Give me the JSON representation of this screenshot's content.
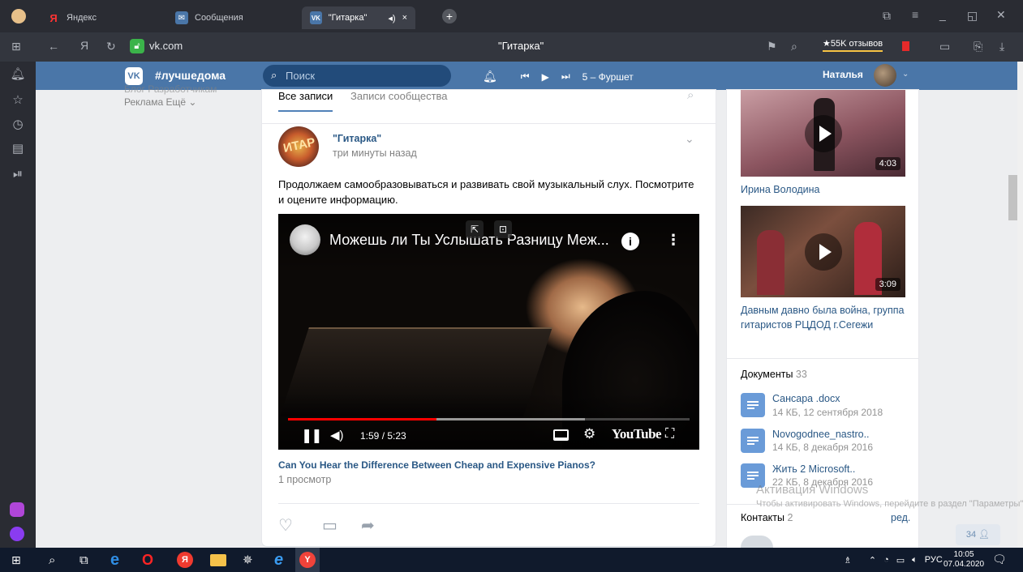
{
  "browser": {
    "tabs": [
      {
        "label": "Яндекс",
        "favicon": "Я"
      },
      {
        "label": "Сообщения",
        "favicon": "VK"
      },
      {
        "label": "\"Гитарка\"",
        "favicon": "VK"
      }
    ],
    "url": "vk.com",
    "page_title": "\"Гитарка\"",
    "reviews": "★55K отзывов"
  },
  "vk_header": {
    "logo": "vk",
    "hashtag": "#лучшедома",
    "search_placeholder": "Поиск",
    "track": "5 – Фуршет",
    "user_name": "Наталья"
  },
  "left_menu": {
    "line1": "Блог  Разработчикам",
    "line2": "Реклама  Ещё ⌄"
  },
  "feed": {
    "tab_all": "Все записи",
    "tab_community": "Записи сообщества",
    "post": {
      "avatar_text": "ИТАР",
      "author": "\"Гитарка\"",
      "time": "три минуты назад",
      "text": "Продолжаем самообразовываться и развивать свой музыкальный слух. Посмотрите и оцените информацию.",
      "video": {
        "title": "Можешь ли Ты Услышать Разницу Меж...",
        "time": "1:59 / 5:23",
        "brand": "YouTube",
        "played_fraction": 0.37,
        "buffered_fraction": 0.74
      },
      "video_caption": "Can You Hear the Difference Between Cheap and Expensive Pianos?",
      "views": "1 просмотр"
    }
  },
  "sidebar": {
    "videos": [
      {
        "duration": "4:03",
        "title": "Ирина Володина"
      },
      {
        "duration": "3:09",
        "title": "Давным давно была война, группа гитаристов РЦДОД г.Сегежи"
      }
    ],
    "documents_label": "Документы",
    "documents_count": "33",
    "documents": [
      {
        "name": "Сансара .docx",
        "meta": "14 КБ, 12 сентября 2018"
      },
      {
        "name": "Novogodnee_nastro..",
        "meta": "14 КБ, 8 декабря 2016"
      },
      {
        "name": "Жить 2 Microsoft..",
        "meta": "22 КБ, 8 декабря 2016"
      }
    ],
    "contacts_label": "Контакты",
    "contacts_count": "2",
    "contacts_edit": "ред."
  },
  "watermark": {
    "line1": "Активация Windows",
    "line2": "Чтобы активировать Windows, перейдите в раздел \"Параметры\"."
  },
  "messages_badge": "34",
  "taskbar": {
    "language": "РУС",
    "time": "10:05",
    "date": "07.04.2020"
  },
  "colors": {
    "vk_blue": "#4a76a8",
    "link": "#2a5885",
    "chrome_dark": "#2a2c33",
    "taskbar": "#101a2c",
    "youtube_red": "#ff0000"
  }
}
